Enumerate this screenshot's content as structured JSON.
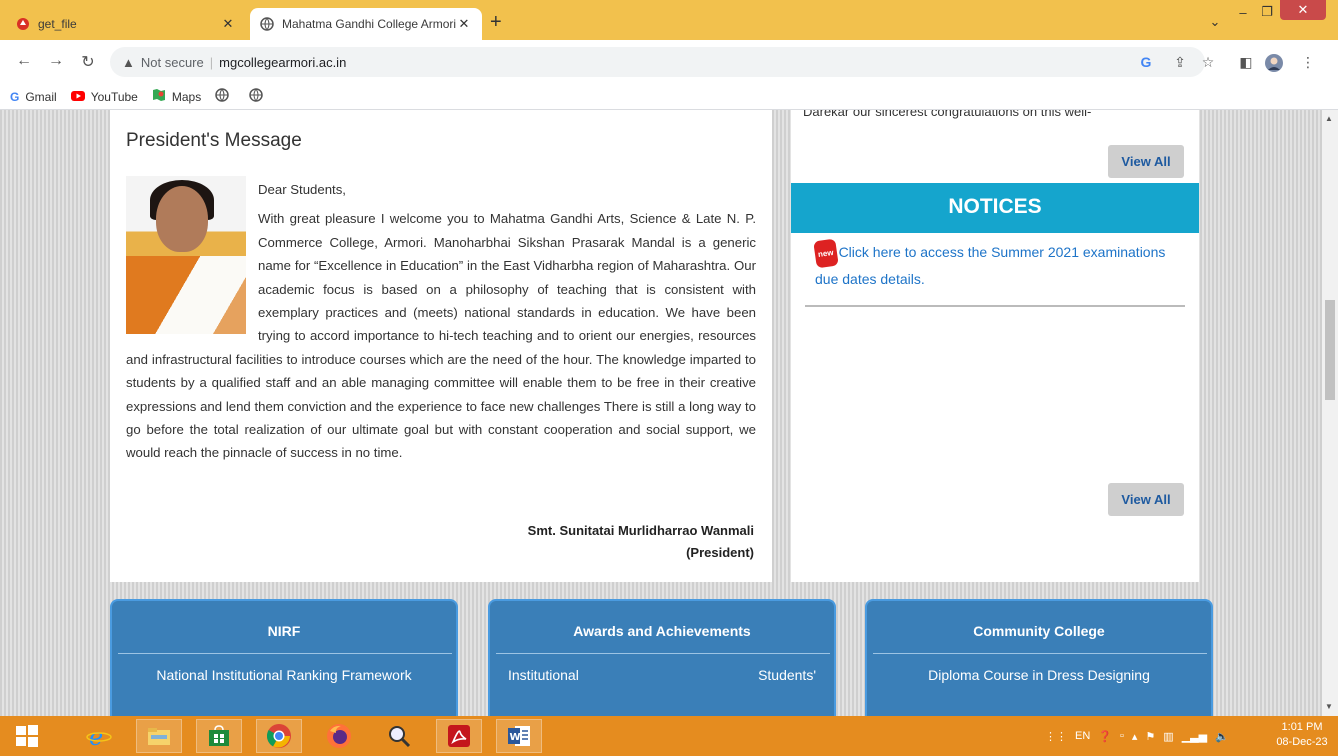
{
  "browser": {
    "tabs": [
      {
        "title": "get_file",
        "active": false
      },
      {
        "title": "Mahatma Gandhi College Armori",
        "active": true
      }
    ],
    "new_tab_label": "+",
    "window_controls": {
      "chevron": "⌄",
      "minimize": "–",
      "maximize": "❐",
      "close": "✕"
    },
    "address": {
      "security_label": "Not secure",
      "url": "mgcollegearmori.ac.in"
    },
    "bookmarks": [
      {
        "label": "Gmail",
        "icon": "google-icon"
      },
      {
        "label": "YouTube",
        "icon": "youtube-icon"
      },
      {
        "label": "Maps",
        "icon": "maps-icon"
      },
      {
        "label": "",
        "icon": "globe-icon"
      },
      {
        "label": "",
        "icon": "globe-icon"
      }
    ]
  },
  "president": {
    "heading": "President's Message",
    "greeting": "Dear Students,",
    "body": "With great pleasure I welcome you to Mahatma Gandhi Arts, Science & Late N. P. Commerce College, Armori. Manoharbhai Sikshan Prasarak Mandal is a generic name for “Excellence in Education” in the East Vidharbha region of Maharashtra. Our academic focus is based on a philosophy of teaching that is consistent with exemplary practices and (meets) national standards in education. We have been trying to accord importance to hi-tech teaching and to orient our energies, resources and infrastructural facilities to introduce courses which are the need of the hour. The knowledge imparted to students by a qualified staff and an able managing committee will enable them to be free in their creative expressions and lend them conviction and the experience to face new challenges There is still a long way to go before the total realization of our ultimate goal but with constant cooperation and social support, we would reach the pinnacle of success in no time.",
    "signature_name": "Smt. Sunitatai Murlidharrao Wanmali",
    "signature_role": "(President)"
  },
  "side": {
    "news_tail": "Darekar our sincerest congratulations on this well-",
    "view_all_label": "View All",
    "notices_heading": "NOTICES",
    "new_badge": "new",
    "notice_text": "Click here to access the Summer 2021 examinations due dates details."
  },
  "cards": [
    {
      "title": "NIRF",
      "subtitle": "National Institutional Ranking Framework"
    },
    {
      "title": "Awards and Achievements",
      "left": "Institutional",
      "right": "Students'"
    },
    {
      "title": "Community College",
      "subtitle": "Diploma Course in Dress Designing"
    }
  ],
  "taskbar": {
    "clock_time": "1:01 PM",
    "clock_date": "08-Dec-23",
    "lang": "EN"
  },
  "colors": {
    "tab_strip": "#f2c14d",
    "notices_header": "#15a5cd",
    "card_bg": "#3a7fb8",
    "link": "#1e74c8",
    "taskbar": "#e58c1f"
  }
}
